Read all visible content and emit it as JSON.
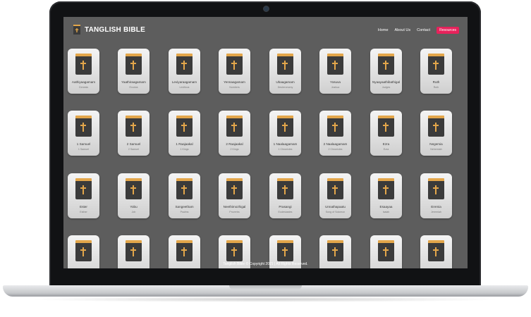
{
  "site": {
    "brand": "TANGLISH BIBLE",
    "nav": [
      "Home",
      "About Us",
      "Contact"
    ],
    "nav_button": "Resources",
    "footer": "Tanglish Bible © Copyright 2021 | All Rights Reserved."
  },
  "colors": {
    "screen_bg": "#5d5d5d",
    "accent": "#e6225b",
    "book_gold": "#e3a64a",
    "book_cover": "#3b3b3b"
  },
  "books": [
    {
      "name": "Aathiyaagamam",
      "sub": "Genesis"
    },
    {
      "name": "Yaathiraagamam",
      "sub": "Exodus"
    },
    {
      "name": "Leviyaraagamam",
      "sub": "Leviticus"
    },
    {
      "name": "Yennaagamam",
      "sub": "Numbers"
    },
    {
      "name": "Ubaagamam",
      "sub": "Deuteronomy"
    },
    {
      "name": "Yosuva",
      "sub": "Joshua"
    },
    {
      "name": "Nyaayaathibathigal",
      "sub": "Judges"
    },
    {
      "name": "Ruth",
      "sub": "Ruth"
    },
    {
      "name": "1 Samuel",
      "sub": "1 Samuel"
    },
    {
      "name": "2 Samuel",
      "sub": "2 Samuel"
    },
    {
      "name": "1 Raajaakal",
      "sub": "1 Kings"
    },
    {
      "name": "2 Raajaakal",
      "sub": "2 Kings"
    },
    {
      "name": "1 Naalaagamam",
      "sub": "1 Chronicles"
    },
    {
      "name": "2 Naalaagamam",
      "sub": "2 Chronicles"
    },
    {
      "name": "Ezra",
      "sub": "Ezra"
    },
    {
      "name": "Negemia",
      "sub": "Nehemiah"
    },
    {
      "name": "Ester",
      "sub": "Esther"
    },
    {
      "name": "Yobu",
      "sub": "Job"
    },
    {
      "name": "Sangeetham",
      "sub": "Psalms"
    },
    {
      "name": "Neethimozhigal",
      "sub": "Proverbs"
    },
    {
      "name": "Prasangi",
      "sub": "Ecclesiastes"
    },
    {
      "name": "Unnathapaatu",
      "sub": "Song of Solomon"
    },
    {
      "name": "Esaayaa",
      "sub": "Isaiah"
    },
    {
      "name": "Eremia",
      "sub": "Jeremiah"
    },
    {
      "name": "",
      "sub": ""
    },
    {
      "name": "",
      "sub": ""
    },
    {
      "name": "",
      "sub": ""
    },
    {
      "name": "",
      "sub": ""
    },
    {
      "name": "",
      "sub": ""
    },
    {
      "name": "",
      "sub": ""
    },
    {
      "name": "",
      "sub": ""
    },
    {
      "name": "",
      "sub": ""
    }
  ]
}
